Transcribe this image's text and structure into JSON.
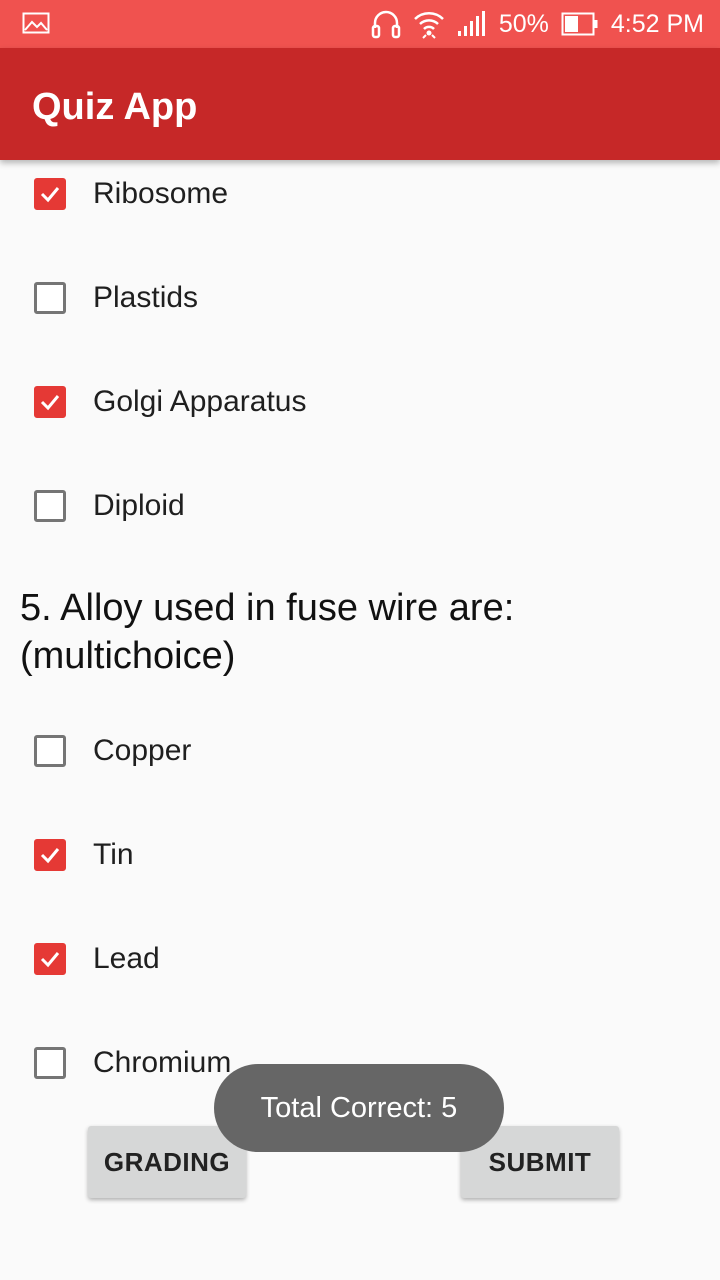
{
  "status_bar": {
    "battery_percent": "50%",
    "time": "4:52 PM",
    "icons": [
      "image-icon",
      "headset-icon",
      "wifi-icon",
      "signal-icon",
      "battery-icon"
    ]
  },
  "app_bar": {
    "title": "Quiz App"
  },
  "question4_options": [
    {
      "label": "Ribosome",
      "checked": true
    },
    {
      "label": "Plastids",
      "checked": false
    },
    {
      "label": "Golgi Apparatus",
      "checked": true
    },
    {
      "label": "Diploid",
      "checked": false
    }
  ],
  "question5": {
    "text": "5. Alloy used in fuse wire are: (multichoice)",
    "options": [
      {
        "label": "Copper",
        "checked": false
      },
      {
        "label": "Tin",
        "checked": true
      },
      {
        "label": "Lead",
        "checked": true
      },
      {
        "label": "Chromium",
        "checked": false
      }
    ]
  },
  "buttons": {
    "grading": "GRADING",
    "submit": "SUBMIT"
  },
  "toast": {
    "text": "Total Correct: 5"
  },
  "colors": {
    "status_bar": "#f0524f",
    "app_bar": "#c62828",
    "accent": "#e53935"
  }
}
